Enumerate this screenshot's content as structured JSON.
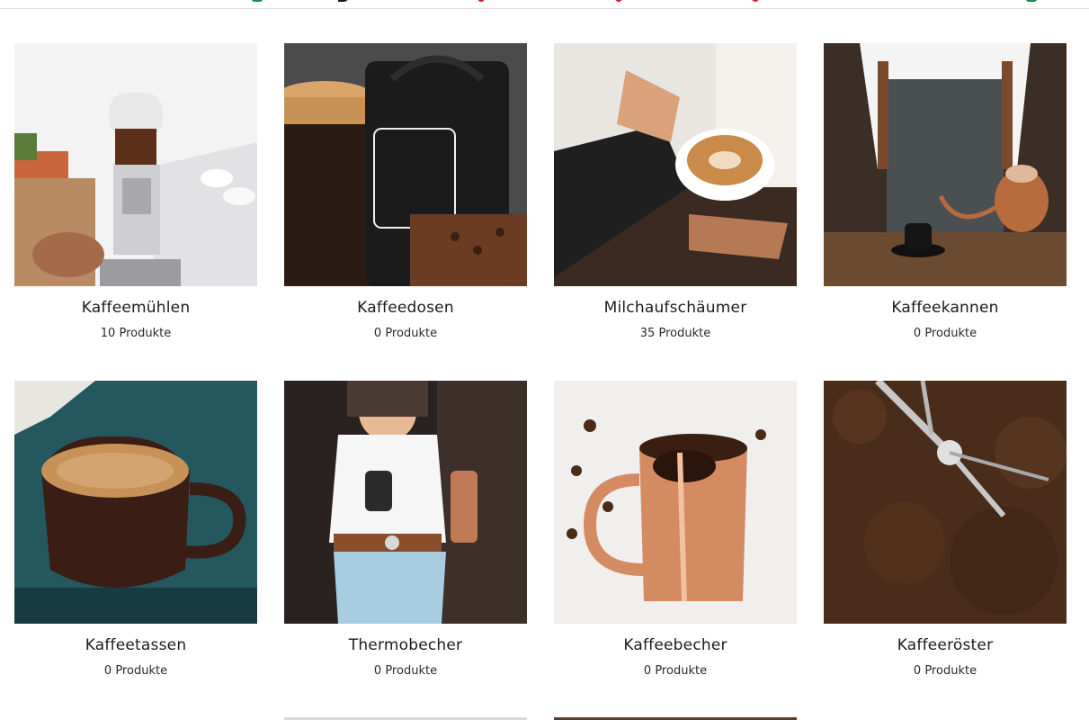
{
  "header": {
    "icons": [
      "cart-icon",
      "user-icon",
      "heart-icon",
      "heart-icon",
      "heart-icon",
      "bag-icon"
    ]
  },
  "categories": [
    {
      "title": "Kaffeemühlen",
      "count": "10 Produkte",
      "image": "coffee-grinder-image"
    },
    {
      "title": "Kaffeedosen",
      "count": "0 Produkte",
      "image": "coffee-canister-image"
    },
    {
      "title": "Milchaufschäumer",
      "count": "35 Produkte",
      "image": "milk-frother-image"
    },
    {
      "title": "Kaffeekannen",
      "count": "0 Produkte",
      "image": "barista-kettle-image"
    },
    {
      "title": "Kaffeetassen",
      "count": "0 Produkte",
      "image": "coffee-cup-image"
    },
    {
      "title": "Thermobecher",
      "count": "0 Produkte",
      "image": "thermo-mug-image"
    },
    {
      "title": "Kaffeebecher",
      "count": "0 Produkte",
      "image": "copper-mug-image"
    },
    {
      "title": "Kaffeeröster",
      "count": "0 Produkte",
      "image": "coffee-roaster-image"
    }
  ],
  "colors": {
    "title": "#1c1c1c",
    "divider": "#dcdcdc",
    "accent_green": "#1e8a4c",
    "accent_red": "#d32030"
  }
}
